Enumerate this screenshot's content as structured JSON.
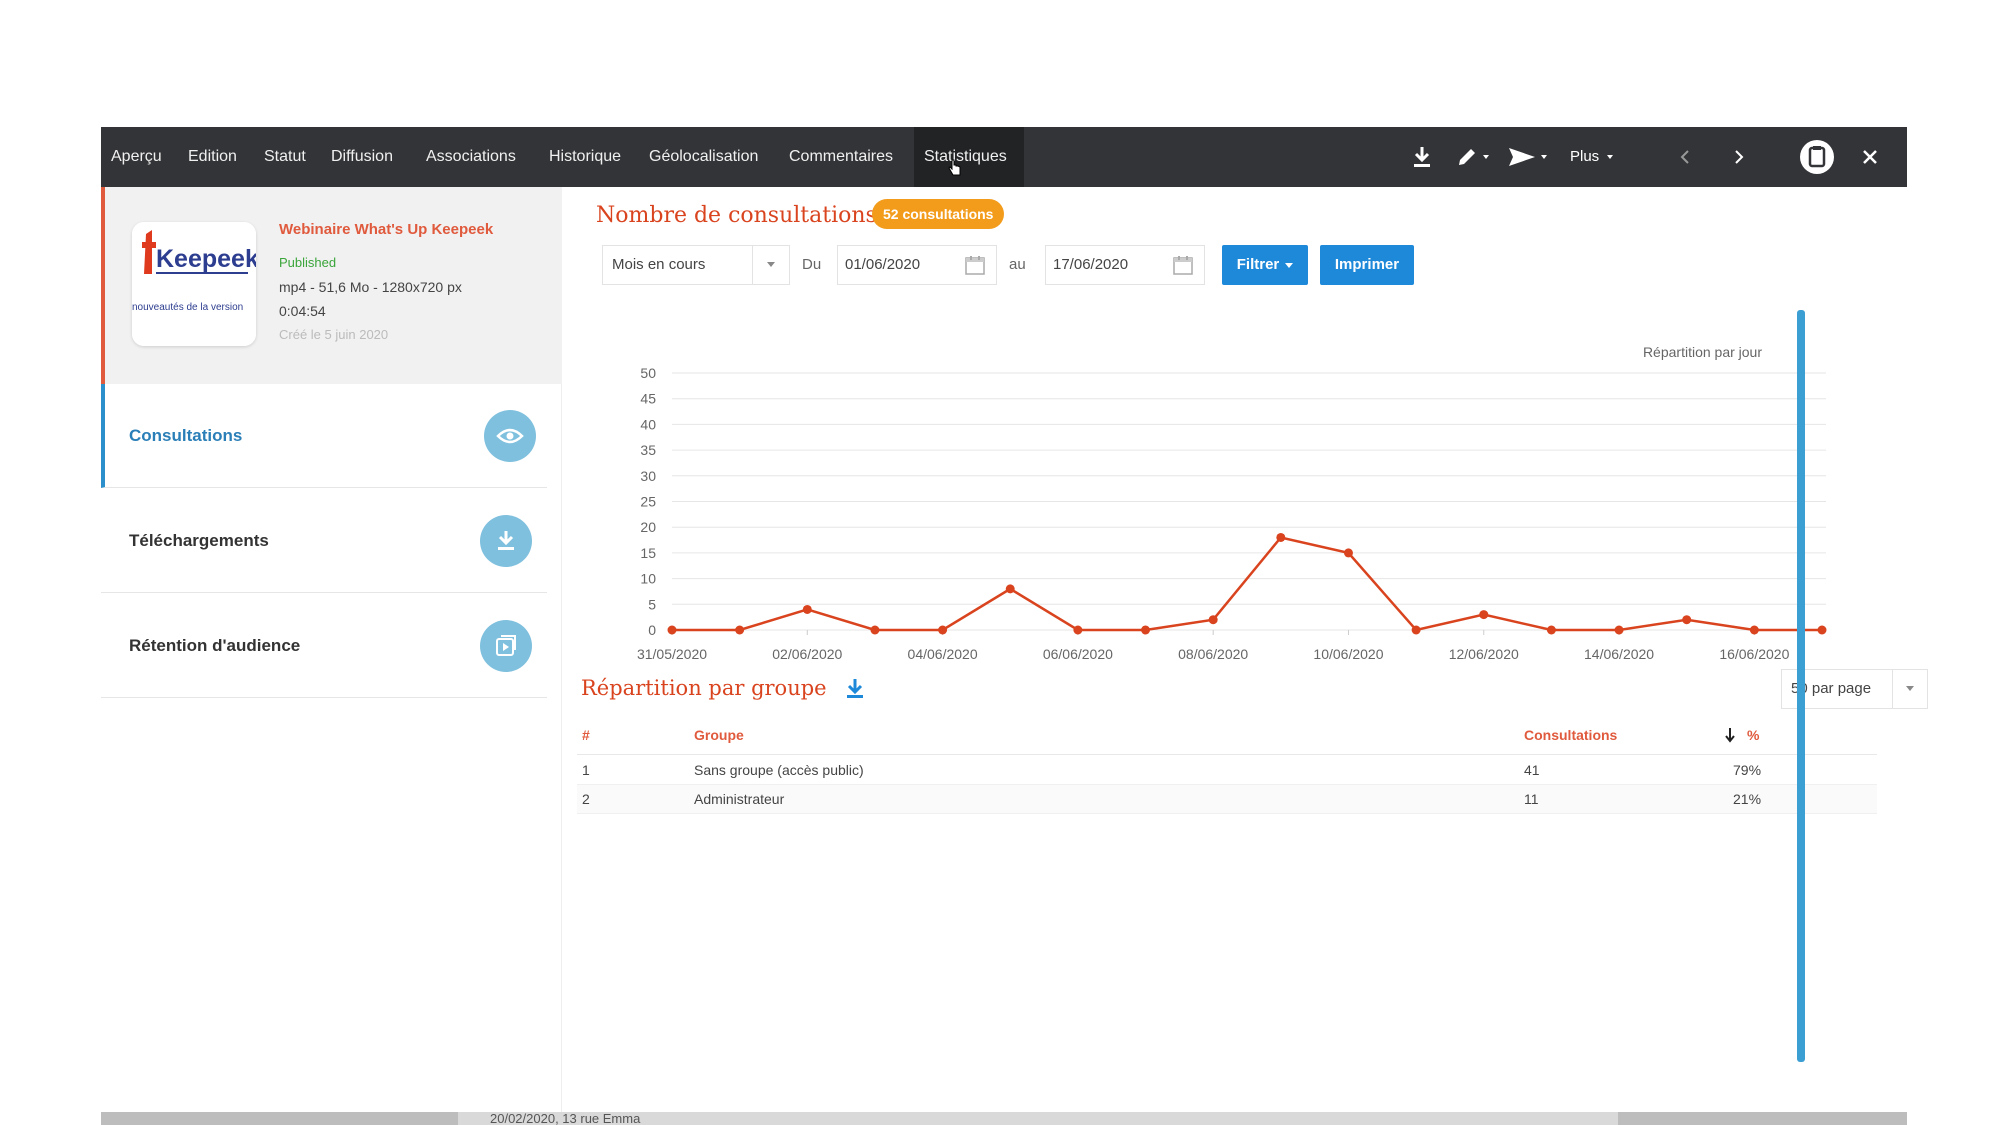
{
  "nav_tabs": [
    {
      "label": "Aperçu"
    },
    {
      "label": "Edition"
    },
    {
      "label": "Statut"
    },
    {
      "label": "Diffusion"
    },
    {
      "label": "Associations"
    },
    {
      "label": "Historique"
    },
    {
      "label": "Géolocalisation"
    },
    {
      "label": "Commentaires"
    },
    {
      "label": "Statistiques",
      "active": true
    }
  ],
  "toolbar": {
    "more_label": "Plus",
    "icons": [
      "download-icon",
      "pencil-icon",
      "send-icon",
      "chevron-left-icon",
      "chevron-right-icon",
      "clipboard-icon",
      "close-icon"
    ]
  },
  "asset": {
    "title": "Webinaire What's Up Keepeek",
    "status": "Published",
    "meta": "mp4 - 51,6 Mo - 1280x720 px",
    "duration": "0:04:54",
    "created": "Créé le 5 juin 2020",
    "thumbnail": {
      "logo_text": "Keepeek",
      "caption": "nouveautés de la version"
    }
  },
  "sidebar": {
    "items": [
      {
        "label": "Consultations",
        "icon": "eye-icon",
        "active": true
      },
      {
        "label": "Téléchargements",
        "icon": "download-icon"
      },
      {
        "label": "Rétention d'audience",
        "icon": "play-icon"
      }
    ]
  },
  "main": {
    "title": "Nombre de consultations",
    "badge": "52 consultations",
    "filters": {
      "period": "Mois en cours",
      "from_label": "Du",
      "from_value": "01/06/2020",
      "to_label": "au",
      "to_value": "17/06/2020",
      "filter_button": "Filtrer",
      "print_button": "Imprimer"
    },
    "group_title": "Répartition par groupe",
    "per_page": "50 par page",
    "table": {
      "headers": {
        "index": "#",
        "group": "Groupe",
        "consultations": "Consultations",
        "percent": "%"
      },
      "rows": [
        {
          "index": "1",
          "group": "Sans groupe (accès public)",
          "consultations": "41",
          "percent": "79%"
        },
        {
          "index": "2",
          "group": "Administrateur",
          "consultations": "11",
          "percent": "21%"
        }
      ]
    }
  },
  "backdrop_text": "20/02/2020, 13 rue Emma",
  "colors": {
    "accent": "#d9441f",
    "badge": "#f39c1c",
    "button": "#1e88d9",
    "topbar": "#333437",
    "line": "#d9441f",
    "nav_circle": "#7fc0de"
  },
  "chart_data": {
    "type": "line",
    "legend": "Répartition par jour",
    "x": [
      "31/05/2020",
      "01/06/2020",
      "02/06/2020",
      "03/06/2020",
      "04/06/2020",
      "05/06/2020",
      "06/06/2020",
      "07/06/2020",
      "08/06/2020",
      "09/06/2020",
      "10/06/2020",
      "11/06/2020",
      "12/06/2020",
      "13/06/2020",
      "14/06/2020",
      "15/06/2020",
      "16/06/2020",
      "17/06/2020"
    ],
    "tick_labels": [
      "31/05/2020",
      "02/06/2020",
      "04/06/2020",
      "06/06/2020",
      "08/06/2020",
      "10/06/2020",
      "12/06/2020",
      "14/06/2020",
      "16/06/2020"
    ],
    "series": [
      {
        "values": [
          0,
          0,
          4,
          0,
          0,
          8,
          0,
          0,
          2,
          18,
          15,
          0,
          3,
          0,
          0,
          2,
          0,
          0
        ]
      }
    ],
    "ylim": [
      0,
      50
    ],
    "yticks": [
      0,
      5,
      10,
      15,
      20,
      25,
      30,
      35,
      40,
      45,
      50
    ],
    "grid": true
  }
}
